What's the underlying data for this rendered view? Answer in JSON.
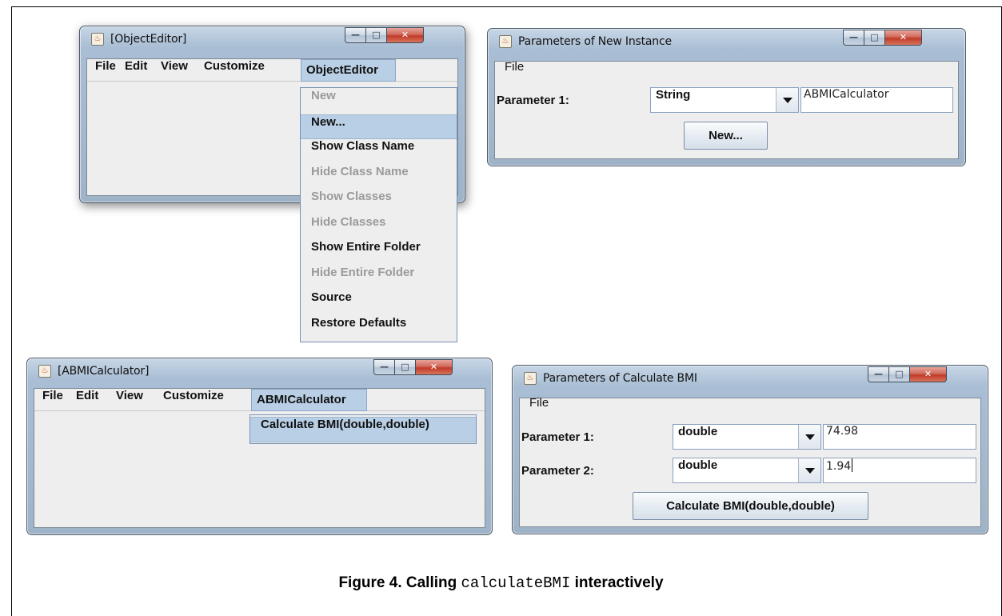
{
  "window_object_editor": {
    "title": "[ObjectEditor]",
    "menus": [
      "File",
      "Edit",
      "View",
      "Customize",
      "ObjectEditor"
    ],
    "popup": [
      {
        "label": "New",
        "enabled": false
      },
      {
        "label": "New...",
        "enabled": true,
        "highlighted": true
      },
      {
        "label": "Show Class Name",
        "enabled": true
      },
      {
        "label": "Hide Class Name",
        "enabled": false
      },
      {
        "label": "Show Classes",
        "enabled": false
      },
      {
        "label": "Hide Classes",
        "enabled": false
      },
      {
        "label": "Show Entire Folder",
        "enabled": true
      },
      {
        "label": "Hide Entire Folder",
        "enabled": false
      },
      {
        "label": "Source",
        "enabled": true
      },
      {
        "label": "Restore Defaults",
        "enabled": true
      }
    ]
  },
  "window_new_instance": {
    "title": "Parameters of New Instance",
    "menu_file": "File",
    "param1_label": "Parameter 1:",
    "param1_type": "String",
    "param1_value": "ABMICalculator",
    "button": "New..."
  },
  "window_abmi": {
    "title": "[ABMICalculator]",
    "menus": [
      "File",
      "Edit",
      "View",
      "Customize",
      "ABMICalculator"
    ],
    "popup_item": "Calculate BMI(double,double)"
  },
  "window_calc_bmi": {
    "title": "Parameters of Calculate BMI",
    "menu_file": "File",
    "param1_label": "Parameter 1:",
    "param1_type": "double",
    "param1_value": "74.98",
    "param2_label": "Parameter 2:",
    "param2_type": "double",
    "param2_value": "1.94",
    "button": "Calculate BMI(double,double)"
  },
  "caption": {
    "prefix": "Figure 4. Calling",
    "code": "calculateBMI",
    "suffix": "interactively"
  },
  "window_controls": {
    "minimize": "minimize-icon",
    "maximize": "maximize-icon",
    "close": "close-icon"
  },
  "colors": {
    "menu_highlight": "#b8cfe5",
    "disabled_text": "#9a9a9a",
    "close_button": "#c03a28"
  }
}
